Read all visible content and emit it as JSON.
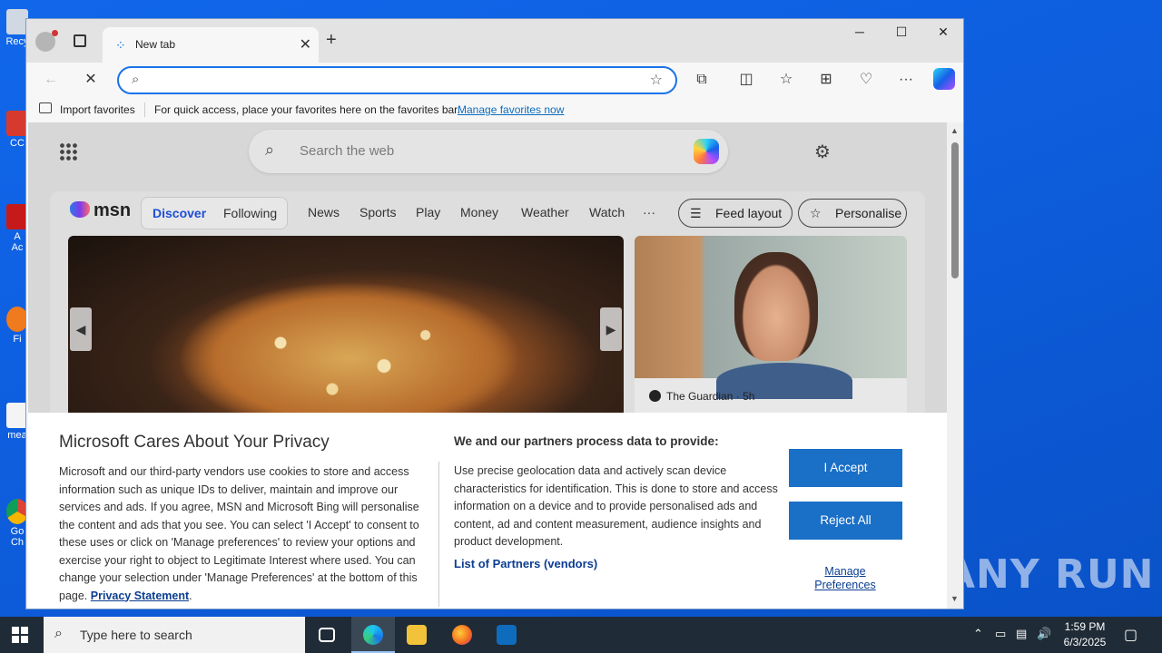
{
  "desktop": {
    "icons": [
      {
        "label": "Recy"
      },
      {
        "label": "CC"
      },
      {
        "label": "A"
      },
      {
        "label": "Ac"
      },
      {
        "label": "Fi"
      },
      {
        "label": "mea"
      },
      {
        "label": "Go"
      },
      {
        "label": "Ch"
      }
    ],
    "watermark": "ANY RUN"
  },
  "browser": {
    "tab": {
      "title": "New tab"
    },
    "address": {
      "value": "",
      "placeholder": ""
    },
    "favorites_bar": {
      "import_label": "Import favorites",
      "message": "For quick access, place your favorites here on the favorites bar.",
      "manage_link": "Manage favorites now"
    }
  },
  "newtab": {
    "search_placeholder": "Search the web",
    "msn": {
      "logo": "msn",
      "segments": {
        "discover": "Discover",
        "following": "Following"
      },
      "categories": [
        "News",
        "Sports",
        "Play",
        "Money",
        "Weather",
        "Watch",
        "···"
      ],
      "feed_layout": "Feed layout",
      "personalise": "Personalise"
    },
    "side_card": {
      "source": "The Guardian",
      "age": "· 5h"
    }
  },
  "privacy": {
    "title": "Microsoft Cares About Your Privacy",
    "body": "Microsoft and our third-party vendors use cookies to store and access information such as unique IDs to deliver, maintain and improve our services and ads. If you agree, MSN and Microsoft Bing will personalise the content and ads that you see. You can select 'I Accept' to consent to these uses or click on 'Manage preferences' to review your options and exercise your right to object to Legitimate Interest where used.  You can change your selection under 'Manage Preferences' at the bottom of this page.",
    "privacy_link": "Privacy Statement",
    "right_title": "We and our partners process data to provide:",
    "right_body": "Use precise geolocation data and actively scan device characteristics for identification. This is done to store and access information on a device and to provide personalised ads and content, ad and content measurement, audience insights and product development.",
    "partners_link": "List of Partners (vendors)",
    "accept": "I Accept",
    "reject": "Reject All",
    "manage_line1": "Manage",
    "manage_line2": "Preferences"
  },
  "taskbar": {
    "search_placeholder": "Type here to search",
    "time": "1:59 PM",
    "date": "6/3/2025"
  },
  "colors": {
    "accent": "#1a6fc7",
    "edge_blue": "#1a73e8",
    "desktop": "#0e5fe0"
  }
}
